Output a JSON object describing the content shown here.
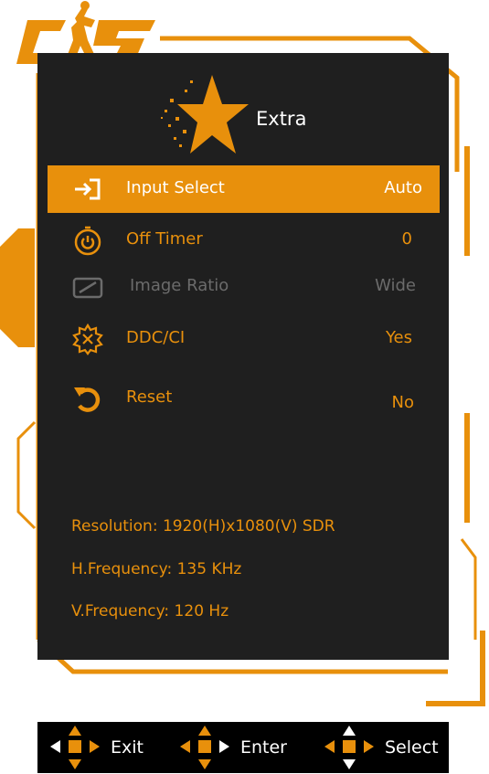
{
  "logo": {
    "text": "CS"
  },
  "header": {
    "title": "Extra"
  },
  "menu": [
    {
      "label": "Input Select",
      "value": "Auto",
      "icon": "input-arrow-icon",
      "state": "selected"
    },
    {
      "label": "Off Timer",
      "value": "0",
      "icon": "timer-icon",
      "state": "normal"
    },
    {
      "label": "Image Ratio",
      "value": "Wide",
      "icon": "aspect-ratio-icon",
      "state": "disabled"
    },
    {
      "label": "DDC/CI",
      "value": "Yes",
      "icon": "ddc-gear-icon",
      "state": "normal"
    },
    {
      "label": "Reset",
      "value": "No",
      "icon": "reset-icon",
      "state": "normal"
    }
  ],
  "info": {
    "resolution": "Resolution: 1920(H)x1080(V) SDR",
    "hfreq": "H.Frequency: 135 KHz",
    "vfreq": "V.Frequency: 120 Hz"
  },
  "footer": {
    "exit": "Exit",
    "enter": "Enter",
    "select": "Select"
  },
  "colors": {
    "accent": "#e8900c",
    "panel": "#1f1f1f",
    "disabled": "#6b6b6b",
    "footer_bg": "#000000"
  }
}
